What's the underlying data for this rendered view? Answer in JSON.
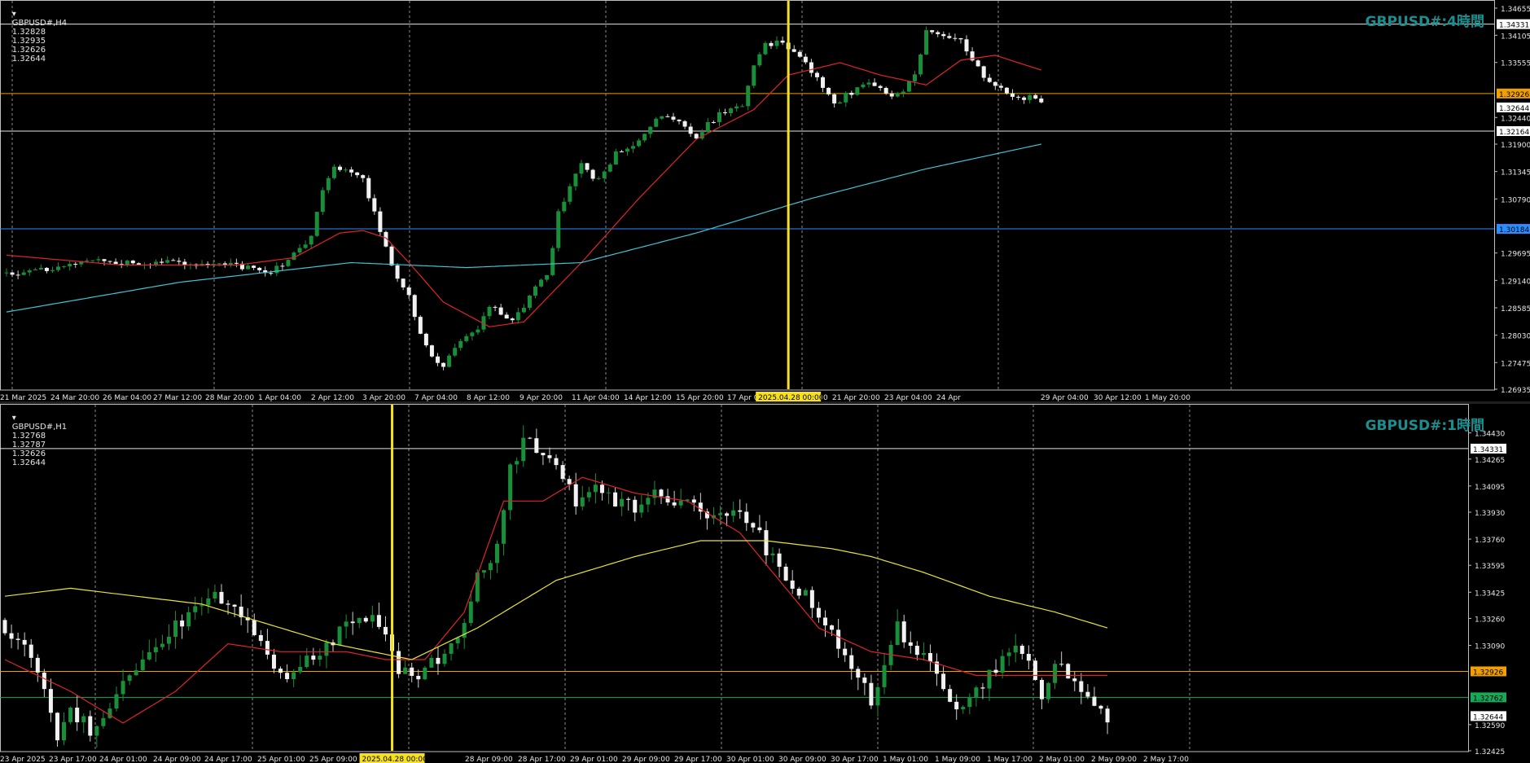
{
  "panels": {
    "h4": {
      "info": {
        "symbol": "GBPUSD#,H4",
        "open": "1.32828",
        "high": "1.32935",
        "low": "1.32626",
        "close": "1.32644"
      },
      "watermark": "GBPUSD#:4時間",
      "cursor_date_label": "2025.04.28 00:00"
    },
    "h1": {
      "info": {
        "symbol": "GBPUSD#,H1",
        "open": "1.32768",
        "high": "1.32787",
        "low": "1.32626",
        "close": "1.32644"
      },
      "watermark": "GBPUSD#:1時間",
      "cursor_date_label": "2025.04.28 00:00"
    }
  },
  "colors": {
    "background": "#000000",
    "bull_candle": "#1a8f3a",
    "bear_candle": "#f2f2f2",
    "ma_fast": "#e0242b",
    "ma_slow_h4": "#3fc4d6",
    "ma_slow_h1": "#e8e33a",
    "cursor_line": "#f7e11c",
    "orange_level": "#f0a000",
    "blue_level": "#2a8cff",
    "green_level": "#19a85a",
    "grid": "#8c8c8c"
  },
  "chart_data": [
    {
      "type": "candlestick",
      "timeframe": "H4",
      "x_ticks": [
        "21 Mar 2025",
        "24 Mar 20:00",
        "26 Mar 04:00",
        "27 Mar 12:00",
        "28 Mar 20:00",
        "1 Apr 04:00",
        "2 Apr 12:00",
        "3 Apr 20:00",
        "7 Apr 04:00",
        "8 Apr 12:00",
        "9 Apr 20:00",
        "11 Apr 04:00",
        "14 Apr 12:00",
        "15 Apr 20:00",
        "17 Apr 04:00",
        "18 Apr 12:00",
        "21 Apr 20:00",
        "23 Apr 04:00",
        "24 Apr",
        "29 Apr 04:00",
        "30 Apr 12:00",
        "1 May 20:00"
      ],
      "y_ticks": [
        "1.34655",
        "1.34105",
        "1.33555",
        "1.32440",
        "1.31900",
        "1.31345",
        "1.30790",
        "1.29695",
        "1.29140",
        "1.28585",
        "1.28030",
        "1.27475",
        "1.26935"
      ],
      "ylim": [
        1.26935,
        1.34655
      ],
      "price_labels": [
        {
          "value": "1.34331",
          "style": "white"
        },
        {
          "value": "1.32926",
          "style": "orange"
        },
        {
          "value": "1.32644",
          "style": "white"
        },
        {
          "value": "1.32164",
          "style": "white"
        },
        {
          "value": "1.30184",
          "style": "blue"
        }
      ],
      "horizontal_levels": [
        1.34331,
        1.32926,
        1.32164,
        1.30184
      ],
      "cursor_index": 136,
      "close_path": [
        [
          0,
          1.2925
        ],
        [
          8,
          1.294
        ],
        [
          14,
          1.2955
        ],
        [
          20,
          1.295
        ],
        [
          28,
          1.295
        ],
        [
          34,
          1.2945
        ],
        [
          40,
          1.2945
        ],
        [
          46,
          1.293
        ],
        [
          50,
          1.2965
        ],
        [
          53,
          1.3
        ],
        [
          55,
          1.31
        ],
        [
          57,
          1.315
        ],
        [
          60,
          1.313
        ],
        [
          62,
          1.312
        ],
        [
          64,
          1.305
        ],
        [
          66,
          1.298
        ],
        [
          68,
          1.292
        ],
        [
          70,
          1.288
        ],
        [
          72,
          1.281
        ],
        [
          74,
          1.276
        ],
        [
          76,
          1.274
        ],
        [
          78,
          1.278
        ],
        [
          80,
          1.28
        ],
        [
          82,
          1.282
        ],
        [
          84,
          1.286
        ],
        [
          86,
          1.285
        ],
        [
          88,
          1.283
        ],
        [
          90,
          1.286
        ],
        [
          92,
          1.29
        ],
        [
          94,
          1.292
        ],
        [
          96,
          1.305
        ],
        [
          98,
          1.31
        ],
        [
          100,
          1.315
        ],
        [
          102,
          1.312
        ],
        [
          104,
          1.313
        ],
        [
          106,
          1.317
        ],
        [
          108,
          1.318
        ],
        [
          110,
          1.32
        ],
        [
          112,
          1.323
        ],
        [
          114,
          1.325
        ],
        [
          116,
          1.324
        ],
        [
          118,
          1.323
        ],
        [
          120,
          1.32
        ],
        [
          122,
          1.323
        ],
        [
          124,
          1.325
        ],
        [
          126,
          1.326
        ],
        [
          128,
          1.327
        ],
        [
          130,
          1.335
        ],
        [
          132,
          1.339
        ],
        [
          134,
          1.3395
        ],
        [
          136,
          1.3385
        ],
        [
          138,
          1.337
        ],
        [
          140,
          1.334
        ],
        [
          142,
          1.331
        ],
        [
          144,
          1.327
        ],
        [
          146,
          1.329
        ],
        [
          148,
          1.33
        ],
        [
          150,
          1.331
        ],
        [
          152,
          1.33
        ],
        [
          154,
          1.329
        ],
        [
          156,
          1.33
        ],
        [
          158,
          1.333
        ],
        [
          160,
          1.342
        ],
        [
          162,
          1.3415
        ],
        [
          164,
          1.3405
        ],
        [
          166,
          1.34
        ],
        [
          168,
          1.336
        ],
        [
          170,
          1.333
        ],
        [
          172,
          1.331
        ],
        [
          174,
          1.329
        ],
        [
          176,
          1.328
        ],
        [
          178,
          1.329
        ],
        [
          180,
          1.327
        ]
      ],
      "series": [
        {
          "name": "",
          "color": "ma_fast",
          "points": [
            [
              0,
              1.2965
            ],
            [
              20,
              1.2945
            ],
            [
              40,
              1.2945
            ],
            [
              50,
              1.296
            ],
            [
              58,
              1.301
            ],
            [
              62,
              1.3015
            ],
            [
              66,
              1.3
            ],
            [
              70,
              1.295
            ],
            [
              76,
              1.287
            ],
            [
              84,
              1.282
            ],
            [
              90,
              1.283
            ],
            [
              100,
              1.295
            ],
            [
              110,
              1.308
            ],
            [
              120,
              1.32
            ],
            [
              130,
              1.326
            ],
            [
              136,
              1.333
            ],
            [
              145,
              1.3355
            ],
            [
              152,
              1.333
            ],
            [
              160,
              1.331
            ],
            [
              166,
              1.336
            ],
            [
              172,
              1.337
            ],
            [
              180,
              1.334
            ]
          ]
        },
        {
          "name": "",
          "color": "ma_slow_h4",
          "points": [
            [
              0,
              1.285
            ],
            [
              30,
              1.291
            ],
            [
              60,
              1.295
            ],
            [
              80,
              1.294
            ],
            [
              100,
              1.295
            ],
            [
              120,
              1.301
            ],
            [
              140,
              1.308
            ],
            [
              160,
              1.314
            ],
            [
              180,
              1.319
            ]
          ]
        }
      ]
    },
    {
      "type": "candlestick",
      "timeframe": "H1",
      "x_ticks": [
        "23 Apr 2025",
        "23 Apr 17:00",
        "24 Apr 01:00",
        "24 Apr 09:00",
        "24 Apr 17:00",
        "25 Apr 01:00",
        "25 Apr 09:00",
        "25 Apr",
        "28 Apr 09:00",
        "28 Apr 17:00",
        "29 Apr 01:00",
        "29 Apr 09:00",
        "29 Apr 17:00",
        "30 Apr 01:00",
        "30 Apr 09:00",
        "30 Apr 17:00",
        "1 May 01:00",
        "1 May 09:00",
        "1 May 17:00",
        "2 May 01:00",
        "2 May 09:00",
        "2 May 17:00"
      ],
      "y_ticks": [
        "1.34430",
        "1.34265",
        "1.34095",
        "1.33930",
        "1.33760",
        "1.33595",
        "1.33425",
        "1.33260",
        "1.33090",
        "1.32590",
        "1.32425"
      ],
      "ylim": [
        1.32425,
        1.345
      ],
      "price_labels": [
        {
          "value": "1.34331",
          "style": "white"
        },
        {
          "value": "1.32926",
          "style": "orange"
        },
        {
          "value": "1.32762",
          "style": "green"
        },
        {
          "value": "1.32644",
          "style": "white"
        }
      ],
      "horizontal_levels": [
        1.34331,
        1.32926,
        1.32762
      ],
      "cursor_index": 59,
      "close_path": [
        [
          0,
          1.332
        ],
        [
          4,
          1.33
        ],
        [
          6,
          1.328
        ],
        [
          8,
          1.325
        ],
        [
          10,
          1.327
        ],
        [
          13,
          1.3255
        ],
        [
          16,
          1.3265
        ],
        [
          19,
          1.329
        ],
        [
          22,
          1.3305
        ],
        [
          25,
          1.3315
        ],
        [
          28,
          1.333
        ],
        [
          31,
          1.334
        ],
        [
          34,
          1.3335
        ],
        [
          37,
          1.3325
        ],
        [
          40,
          1.33
        ],
        [
          43,
          1.329
        ],
        [
          46,
          1.33
        ],
        [
          49,
          1.331
        ],
        [
          52,
          1.332
        ],
        [
          55,
          1.3325
        ],
        [
          58,
          1.332
        ],
        [
          60,
          1.3295
        ],
        [
          63,
          1.329
        ],
        [
          66,
          1.33
        ],
        [
          69,
          1.331
        ],
        [
          72,
          1.335
        ],
        [
          75,
          1.337
        ],
        [
          77,
          1.342
        ],
        [
          79,
          1.344
        ],
        [
          81,
          1.343
        ],
        [
          84,
          1.342
        ],
        [
          87,
          1.34
        ],
        [
          90,
          1.341
        ],
        [
          93,
          1.34
        ],
        [
          96,
          1.3395
        ],
        [
          99,
          1.341
        ],
        [
          102,
          1.34
        ],
        [
          105,
          1.3395
        ],
        [
          108,
          1.339
        ],
        [
          111,
          1.3395
        ],
        [
          114,
          1.3385
        ],
        [
          116,
          1.337
        ],
        [
          118,
          1.3355
        ],
        [
          120,
          1.3345
        ],
        [
          122,
          1.334
        ],
        [
          124,
          1.333
        ],
        [
          126,
          1.332
        ],
        [
          128,
          1.33
        ],
        [
          130,
          1.329
        ],
        [
          132,
          1.3275
        ],
        [
          134,
          1.33
        ],
        [
          136,
          1.332
        ],
        [
          138,
          1.331
        ],
        [
          140,
          1.33
        ],
        [
          142,
          1.329
        ],
        [
          144,
          1.327
        ],
        [
          146,
          1.3275
        ],
        [
          148,
          1.328
        ],
        [
          150,
          1.329
        ],
        [
          152,
          1.33
        ],
        [
          154,
          1.331
        ],
        [
          156,
          1.3295
        ],
        [
          158,
          1.328
        ],
        [
          160,
          1.33
        ],
        [
          162,
          1.329
        ],
        [
          164,
          1.3275
        ],
        [
          166,
          1.327
        ],
        [
          168,
          1.3264
        ]
      ],
      "series": [
        {
          "name": "",
          "color": "ma_fast",
          "points": [
            [
              0,
              1.33
            ],
            [
              10,
              1.328
            ],
            [
              18,
              1.326
            ],
            [
              26,
              1.328
            ],
            [
              34,
              1.331
            ],
            [
              42,
              1.3305
            ],
            [
              52,
              1.3305
            ],
            [
              58,
              1.33
            ],
            [
              64,
              1.33
            ],
            [
              70,
              1.333
            ],
            [
              76,
              1.34
            ],
            [
              82,
              1.34
            ],
            [
              88,
              1.3415
            ],
            [
              96,
              1.3405
            ],
            [
              104,
              1.34
            ],
            [
              112,
              1.338
            ],
            [
              118,
              1.335
            ],
            [
              124,
              1.332
            ],
            [
              132,
              1.3305
            ],
            [
              140,
              1.33
            ],
            [
              148,
              1.329
            ],
            [
              156,
              1.329
            ],
            [
              162,
              1.329
            ],
            [
              168,
              1.329
            ]
          ]
        },
        {
          "name": "",
          "color": "ma_slow_h1",
          "points": [
            [
              0,
              1.334
            ],
            [
              10,
              1.3345
            ],
            [
              30,
              1.3335
            ],
            [
              50,
              1.331
            ],
            [
              62,
              1.33
            ],
            [
              72,
              1.332
            ],
            [
              84,
              1.335
            ],
            [
              96,
              1.3365
            ],
            [
              106,
              1.3375
            ],
            [
              116,
              1.3375
            ],
            [
              126,
              1.337
            ],
            [
              132,
              1.3365
            ],
            [
              140,
              1.3355
            ],
            [
              150,
              1.334
            ],
            [
              160,
              1.333
            ],
            [
              168,
              1.332
            ]
          ]
        }
      ]
    }
  ]
}
